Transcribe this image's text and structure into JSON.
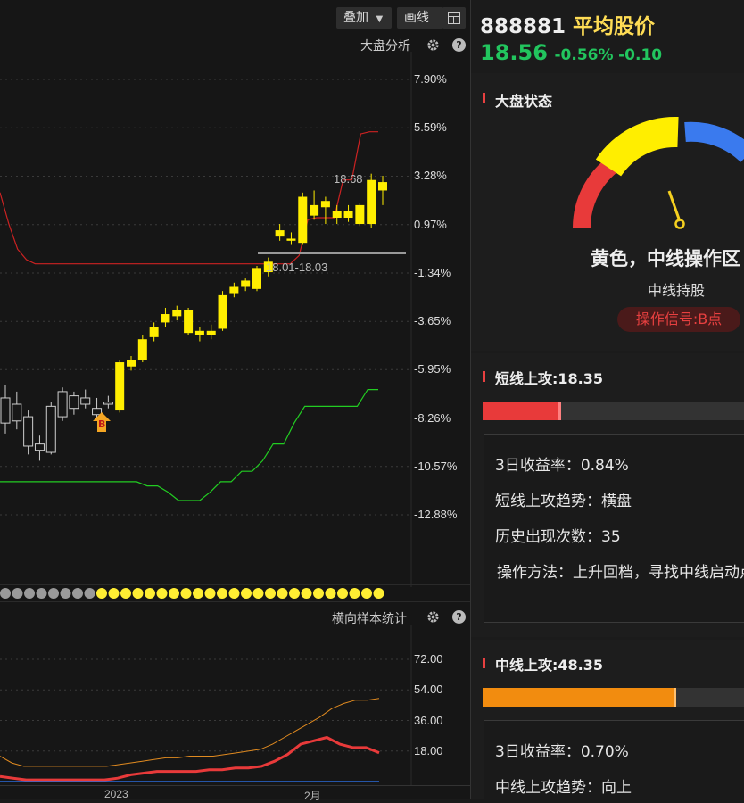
{
  "toolbar": {
    "overlay_label": "叠加",
    "draw_label": "画线"
  },
  "main_chart": {
    "title": "大盘分析",
    "y_ticks": [
      "7.90%",
      "5.59%",
      "3.28%",
      "0.97%",
      "-1.34%",
      "-3.65%",
      "-5.95%",
      "-8.26%",
      "-10.57%",
      "-12.88%"
    ],
    "high_label": "18.68",
    "range_label": "18.01-18.03",
    "signal_marker": "B"
  },
  "sub_chart": {
    "title": "横向样本统计",
    "y_ticks": [
      "72.00",
      "54.00",
      "36.00",
      "18.00"
    ],
    "x_ticks": [
      "2023",
      "2月"
    ]
  },
  "quote": {
    "code": "888881",
    "name": "平均股价",
    "price": "18.56",
    "change_pct": "-0.56%",
    "change": "-0.10",
    "up_color": "#ffdd55",
    "down_color": "#22c55e"
  },
  "market_state": {
    "title": "大盘状态",
    "status": "黄色，中线操作区",
    "advice": "中线持股",
    "signal": "操作信号:B点",
    "gauge_colors": [
      "#e83a3a",
      "#ffee00",
      "#3a7aee"
    ]
  },
  "short_term": {
    "title": "短线上攻:18.35",
    "progress": 0.29,
    "color": "#e83a3a",
    "stats": [
      "3日收益率：0.84%",
      "短线上攻趋势：横盘",
      "历史出现次数：35",
      "操作方法：上升回档，寻找中线启动点"
    ]
  },
  "mid_term": {
    "title": "中线上攻:48.35",
    "progress": 0.73,
    "color": "#f28c0f",
    "stats": [
      "3日收益率：0.70%",
      "中线上攻趋势：向上"
    ]
  },
  "chart_data": {
    "type": "line",
    "title": "",
    "ylim_main_pct": [
      -12.88,
      7.9
    ],
    "ylim_sub": [
      0,
      72
    ],
    "candles": [
      {
        "o": -8.5,
        "c": -7.3,
        "h": -6.7,
        "l": -9.0,
        "up": false
      },
      {
        "o": -7.6,
        "c": -8.4,
        "h": -7.0,
        "l": -8.8,
        "up": false
      },
      {
        "o": -8.2,
        "c": -9.6,
        "h": -7.9,
        "l": -10.0,
        "up": false
      },
      {
        "o": -9.5,
        "c": -9.8,
        "h": -9.1,
        "l": -10.3,
        "up": false
      },
      {
        "o": -9.9,
        "c": -7.7,
        "h": -7.5,
        "l": -10.0,
        "up": false
      },
      {
        "o": -8.2,
        "c": -7.0,
        "h": -6.8,
        "l": -8.4,
        "up": false
      },
      {
        "o": -7.2,
        "c": -7.8,
        "h": -7.0,
        "l": -8.1,
        "up": false
      },
      {
        "o": -7.6,
        "c": -7.3,
        "h": -6.9,
        "l": -7.8,
        "up": false
      },
      {
        "o": -7.8,
        "c": -8.1,
        "h": -7.3,
        "l": -8.3,
        "up": false
      },
      {
        "o": -7.6,
        "c": -7.5,
        "h": -7.2,
        "l": -7.8,
        "up": false
      },
      {
        "o": -7.9,
        "c": -5.6,
        "h": -5.5,
        "l": -8.0,
        "up": true
      },
      {
        "o": -5.8,
        "c": -5.5,
        "h": -5.3,
        "l": -6.0,
        "up": true
      },
      {
        "o": -5.5,
        "c": -4.5,
        "h": -4.3,
        "l": -5.6,
        "up": true
      },
      {
        "o": -4.4,
        "c": -3.9,
        "h": -3.7,
        "l": -4.6,
        "up": true
      },
      {
        "o": -3.7,
        "c": -3.3,
        "h": -3.0,
        "l": -3.9,
        "up": true
      },
      {
        "o": -3.4,
        "c": -3.1,
        "h": -2.9,
        "l": -3.6,
        "up": true
      },
      {
        "o": -3.1,
        "c": -4.2,
        "h": -3.0,
        "l": -4.3,
        "up": true
      },
      {
        "o": -4.1,
        "c": -4.3,
        "h": -3.9,
        "l": -4.6,
        "up": true
      },
      {
        "o": -4.3,
        "c": -4.1,
        "h": -3.8,
        "l": -4.5,
        "up": true
      },
      {
        "o": -4.0,
        "c": -2.4,
        "h": -2.2,
        "l": -4.1,
        "up": true
      },
      {
        "o": -2.3,
        "c": -2.0,
        "h": -1.8,
        "l": -2.5,
        "up": true
      },
      {
        "o": -2.0,
        "c": -1.7,
        "h": -1.6,
        "l": -2.2,
        "up": true
      },
      {
        "o": -2.1,
        "c": -1.1,
        "h": -1.0,
        "l": -2.2,
        "up": true
      },
      {
        "o": -1.3,
        "c": -0.8,
        "h": -0.6,
        "l": -1.5,
        "up": true
      },
      {
        "o": 0.4,
        "c": 0.7,
        "h": 1.0,
        "l": 0.2,
        "up": true
      },
      {
        "o": 0.2,
        "c": 0.3,
        "h": 0.6,
        "l": 0.0,
        "up": true
      },
      {
        "o": 0.1,
        "c": 2.3,
        "h": 2.5,
        "l": 0.0,
        "up": true
      },
      {
        "o": 1.4,
        "c": 1.9,
        "h": 2.6,
        "l": 1.2,
        "up": true
      },
      {
        "o": 2.1,
        "c": 1.8,
        "h": 2.3,
        "l": 1.0,
        "up": true
      },
      {
        "o": 1.6,
        "c": 1.3,
        "h": 1.9,
        "l": 1.0,
        "up": true
      },
      {
        "o": 1.3,
        "c": 1.6,
        "h": 1.9,
        "l": 1.1,
        "up": true
      },
      {
        "o": 1.9,
        "c": 1.0,
        "h": 2.0,
        "l": 0.9,
        "up": true
      },
      {
        "o": 1.0,
        "c": 3.1,
        "h": 3.4,
        "l": 0.8,
        "up": true
      },
      {
        "o": 2.6,
        "c": 3.0,
        "h": 3.3,
        "l": 1.9,
        "up": true
      }
    ],
    "series": [
      {
        "values": [
          2.5,
          1.0,
          -0.2,
          -0.7,
          -0.9,
          -0.9,
          -0.9,
          -0.9,
          -0.9,
          -0.9,
          -0.9,
          -0.9,
          -0.9,
          -0.9,
          -0.9,
          -0.9,
          -0.9,
          -0.9,
          -0.9,
          -0.9,
          -0.9,
          -0.9,
          -0.9,
          -0.9,
          -0.9,
          -0.9,
          -0.9,
          -0.9,
          -0.9,
          -0.9,
          -0.9,
          -0.9,
          -0.9,
          -0.9,
          -0.5,
          1.2,
          1.3,
          1.3,
          1.3,
          3.1,
          3.1,
          5.3,
          5.4,
          5.4
        ]
      },
      {
        "values": [
          -11.3,
          -11.3,
          -11.3,
          -11.3,
          -11.3,
          -11.3,
          -11.3,
          -11.3,
          -11.3,
          -11.3,
          -11.3,
          -11.3,
          -11.3,
          -11.3,
          -11.5,
          -11.5,
          -11.8,
          -12.2,
          -12.2,
          -12.2,
          -11.8,
          -11.3,
          -11.3,
          -10.8,
          -10.8,
          -10.3,
          -9.5,
          -9.5,
          -8.5,
          -7.7,
          -7.7,
          -7.7,
          -7.7,
          -7.7,
          -7.7,
          -6.9,
          -6.9
        ]
      }
    ],
    "sub_series": [
      {
        "values": [
          15,
          11,
          9,
          9,
          9,
          9,
          9,
          9,
          9,
          9,
          10,
          11,
          12,
          13,
          14,
          14,
          15,
          15,
          15,
          16,
          17,
          18,
          19,
          22,
          26,
          30,
          34,
          38,
          43,
          46,
          48,
          48,
          49
        ]
      },
      {
        "values": [
          3,
          2,
          1,
          1,
          1,
          1,
          1,
          1,
          1,
          2,
          4,
          5,
          6,
          6,
          6,
          6,
          7,
          7,
          8,
          8,
          9,
          12,
          16,
          22,
          24,
          26,
          22,
          20,
          20,
          17
        ]
      }
    ]
  }
}
